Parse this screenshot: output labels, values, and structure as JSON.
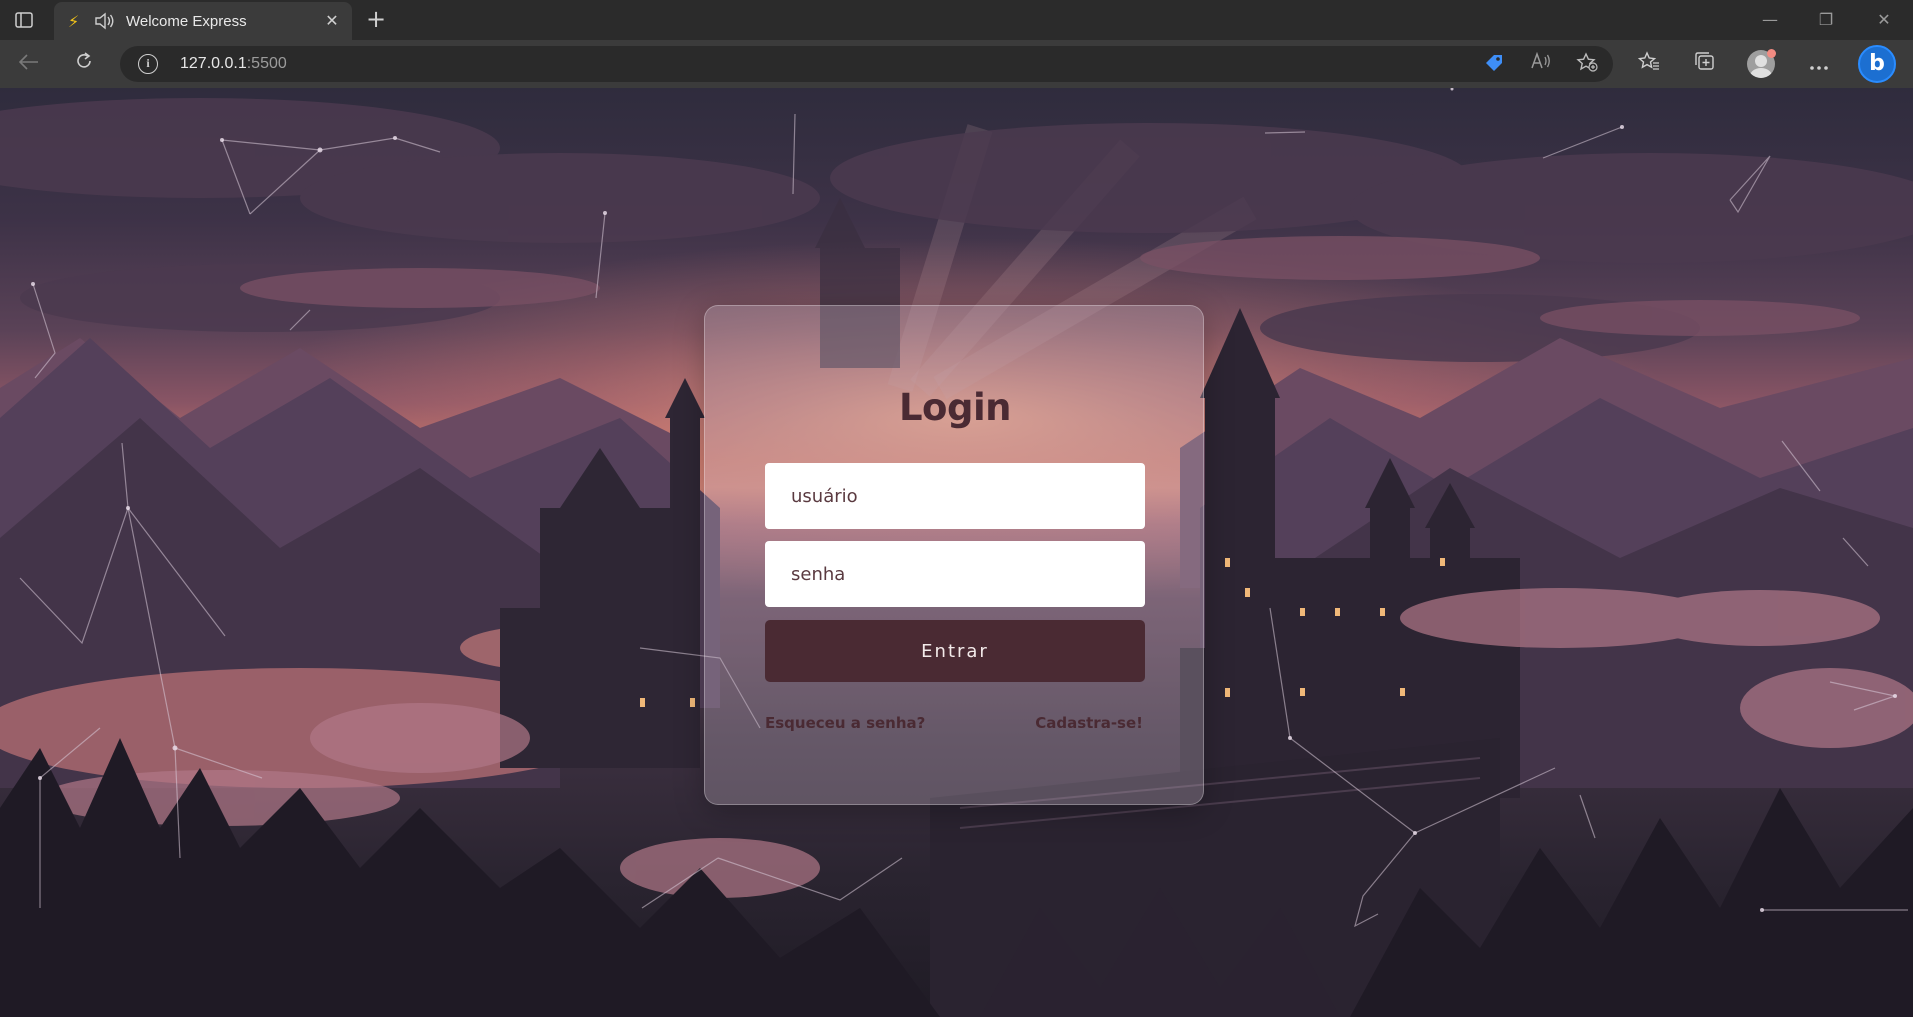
{
  "browser": {
    "tab": {
      "title": "Welcome Express",
      "close_glyph": "✕",
      "icon": "lightning-bolt-icon"
    },
    "new_tab_glyph": "+",
    "window_controls": {
      "minimize": "—",
      "restore": "❐",
      "close": "✕"
    },
    "address": {
      "host": "127.0.0.1",
      "port": ":5500"
    },
    "toolbar_icons": [
      "coupon-tag-icon",
      "read-aloud-icon",
      "add-favorite-icon",
      "favorites-icon",
      "collections-icon",
      "profile-icon",
      "more-icon",
      "bing-copilot-icon"
    ]
  },
  "login": {
    "title": "Login",
    "username_placeholder": "usuário",
    "password_placeholder": "senha",
    "submit_label": "Entrar",
    "forgot_link": "Esqueceu a senha?",
    "signup_link": "Cadastra-se!"
  },
  "colors": {
    "accent": "#4a2a33",
    "tab_bolt": "#f5c518",
    "bing": "#1c6fd1"
  }
}
